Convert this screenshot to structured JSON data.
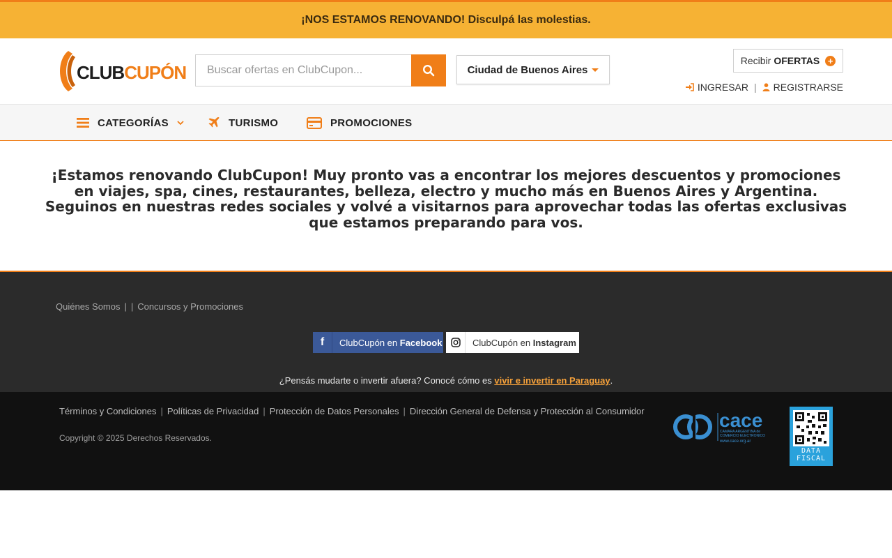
{
  "banner": {
    "text": "¡NOS ESTAMOS RENOVANDO! Disculpá las molestias."
  },
  "header": {
    "logo": {
      "part1": "CLUB",
      "part2": "CUPÓN"
    },
    "search": {
      "placeholder": "Buscar ofertas en ClubCupon..."
    },
    "city": {
      "selected": "Ciudad de Buenos Aires"
    },
    "recibir": {
      "prefix": "Recibir",
      "strong": "OFERTAS"
    },
    "auth": {
      "login": "INGRESAR",
      "register": "REGISTRARSE"
    }
  },
  "nav": {
    "items": [
      {
        "label": "CATEGORÍAS",
        "icon": "menu-icon"
      },
      {
        "label": "TURISMO",
        "icon": "plane-icon"
      },
      {
        "label": "PROMOCIONES",
        "icon": "credit-card-icon"
      }
    ]
  },
  "main": {
    "message": "¡Estamos renovando ClubCupon! Muy pronto vas a encontrar los mejores descuentos y promociones en viajes, spa, cines, restaurantes, belleza, electro y mucho más en Buenos Aires y Argentina. Seguinos en nuestras redes sociales y volvé a visitarnos para aprovechar todas las ofertas exclusivas que estamos preparando para vos."
  },
  "footer": {
    "links": [
      "Quiénes Somos",
      "Concursos y Promociones"
    ],
    "social": {
      "facebook": {
        "prefix": "ClubCupón en",
        "strong": "Facebook"
      },
      "instagram": {
        "prefix": "ClubCupón en",
        "strong": "Instagram"
      }
    },
    "paraguay": {
      "text": "¿Pensás mudarte o invertir afuera? Conocé cómo es",
      "link": "vivir e invertir en Paraguay",
      "suffix": "."
    }
  },
  "bottom": {
    "links": [
      "Términos y Condiciones",
      "Políticas de Privacidad",
      "Protección de Datos Personales",
      "Dirección General de Defensa y Protección al Consumidor"
    ],
    "copyright": "Copyright © 2025 Derechos Reservados.",
    "cace": {
      "name": "cace",
      "line1": "CAMARA ARGENTINA de",
      "line2": "COMERCIO ELECTRONICO",
      "url": "www.cace.org.ar"
    },
    "datafiscal": {
      "line1": "DATA",
      "line2": "FISCAL"
    }
  },
  "colors": {
    "accent": "#f07e18",
    "banner": "#f6b234",
    "footer": "#2b2b2b",
    "bottom": "#111111",
    "facebook": "#3b5998",
    "qr": "#2aa2dc"
  }
}
